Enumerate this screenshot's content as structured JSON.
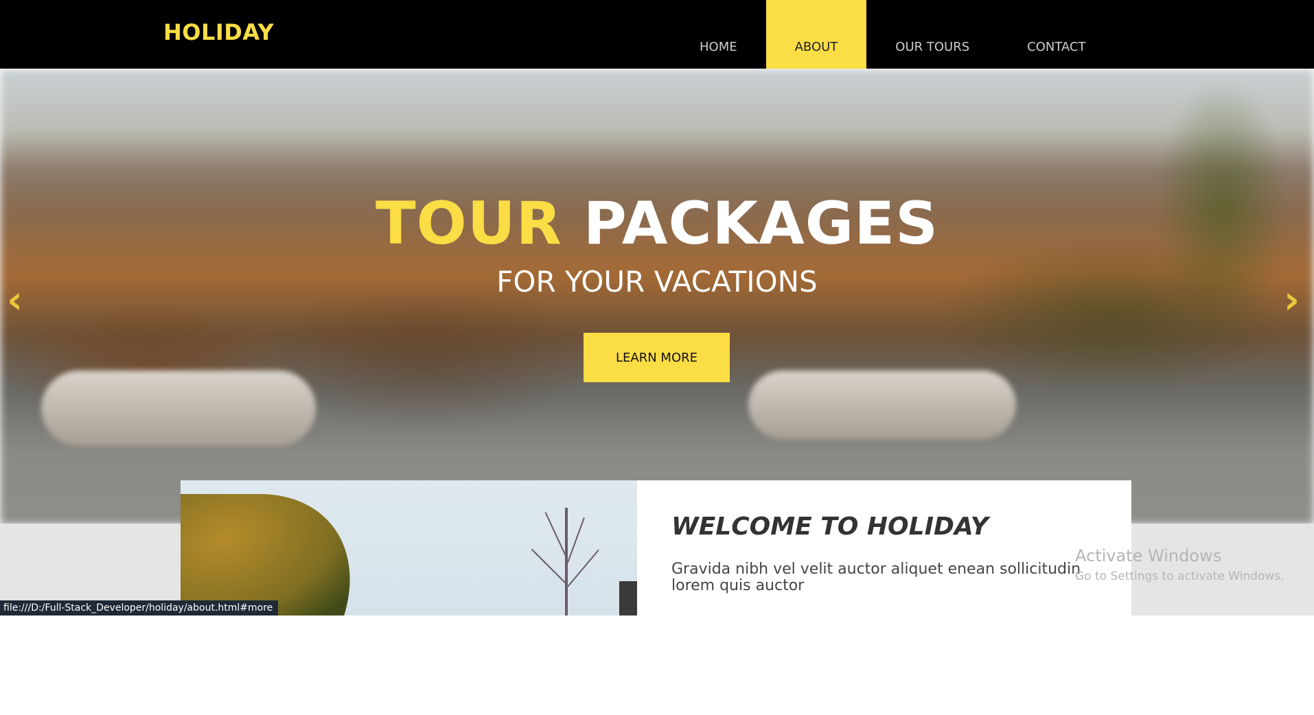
{
  "brand": "HOLIDAY",
  "nav": {
    "items": [
      {
        "label": "HOME"
      },
      {
        "label": "ABOUT"
      },
      {
        "label": "OUR TOURS"
      },
      {
        "label": "CONTACT"
      }
    ],
    "active": "ABOUT"
  },
  "hero": {
    "title_accent": "TOUR",
    "title_rest": "PACKAGES",
    "subtitle": "FOR YOUR VACATIONS",
    "cta_label": "LEARN MORE",
    "prev_arrow": "‹",
    "next_arrow": "›"
  },
  "welcome": {
    "title": "WELCOME TO HOLIDAY",
    "body": "Gravida nibh vel velit auctor aliquet enean sollicitudin lorem quis auctor"
  },
  "watermark": {
    "line1": "Activate Windows",
    "line2": "Go to Settings to activate Windows."
  },
  "status_url": "file:///D:/Full-Stack_Developer/holiday/about.html#more",
  "colors": {
    "accent": "#fbdd45",
    "navbar": "#000000"
  },
  "icons": {
    "prev": "chevron-left-icon",
    "next": "chevron-right-icon"
  }
}
